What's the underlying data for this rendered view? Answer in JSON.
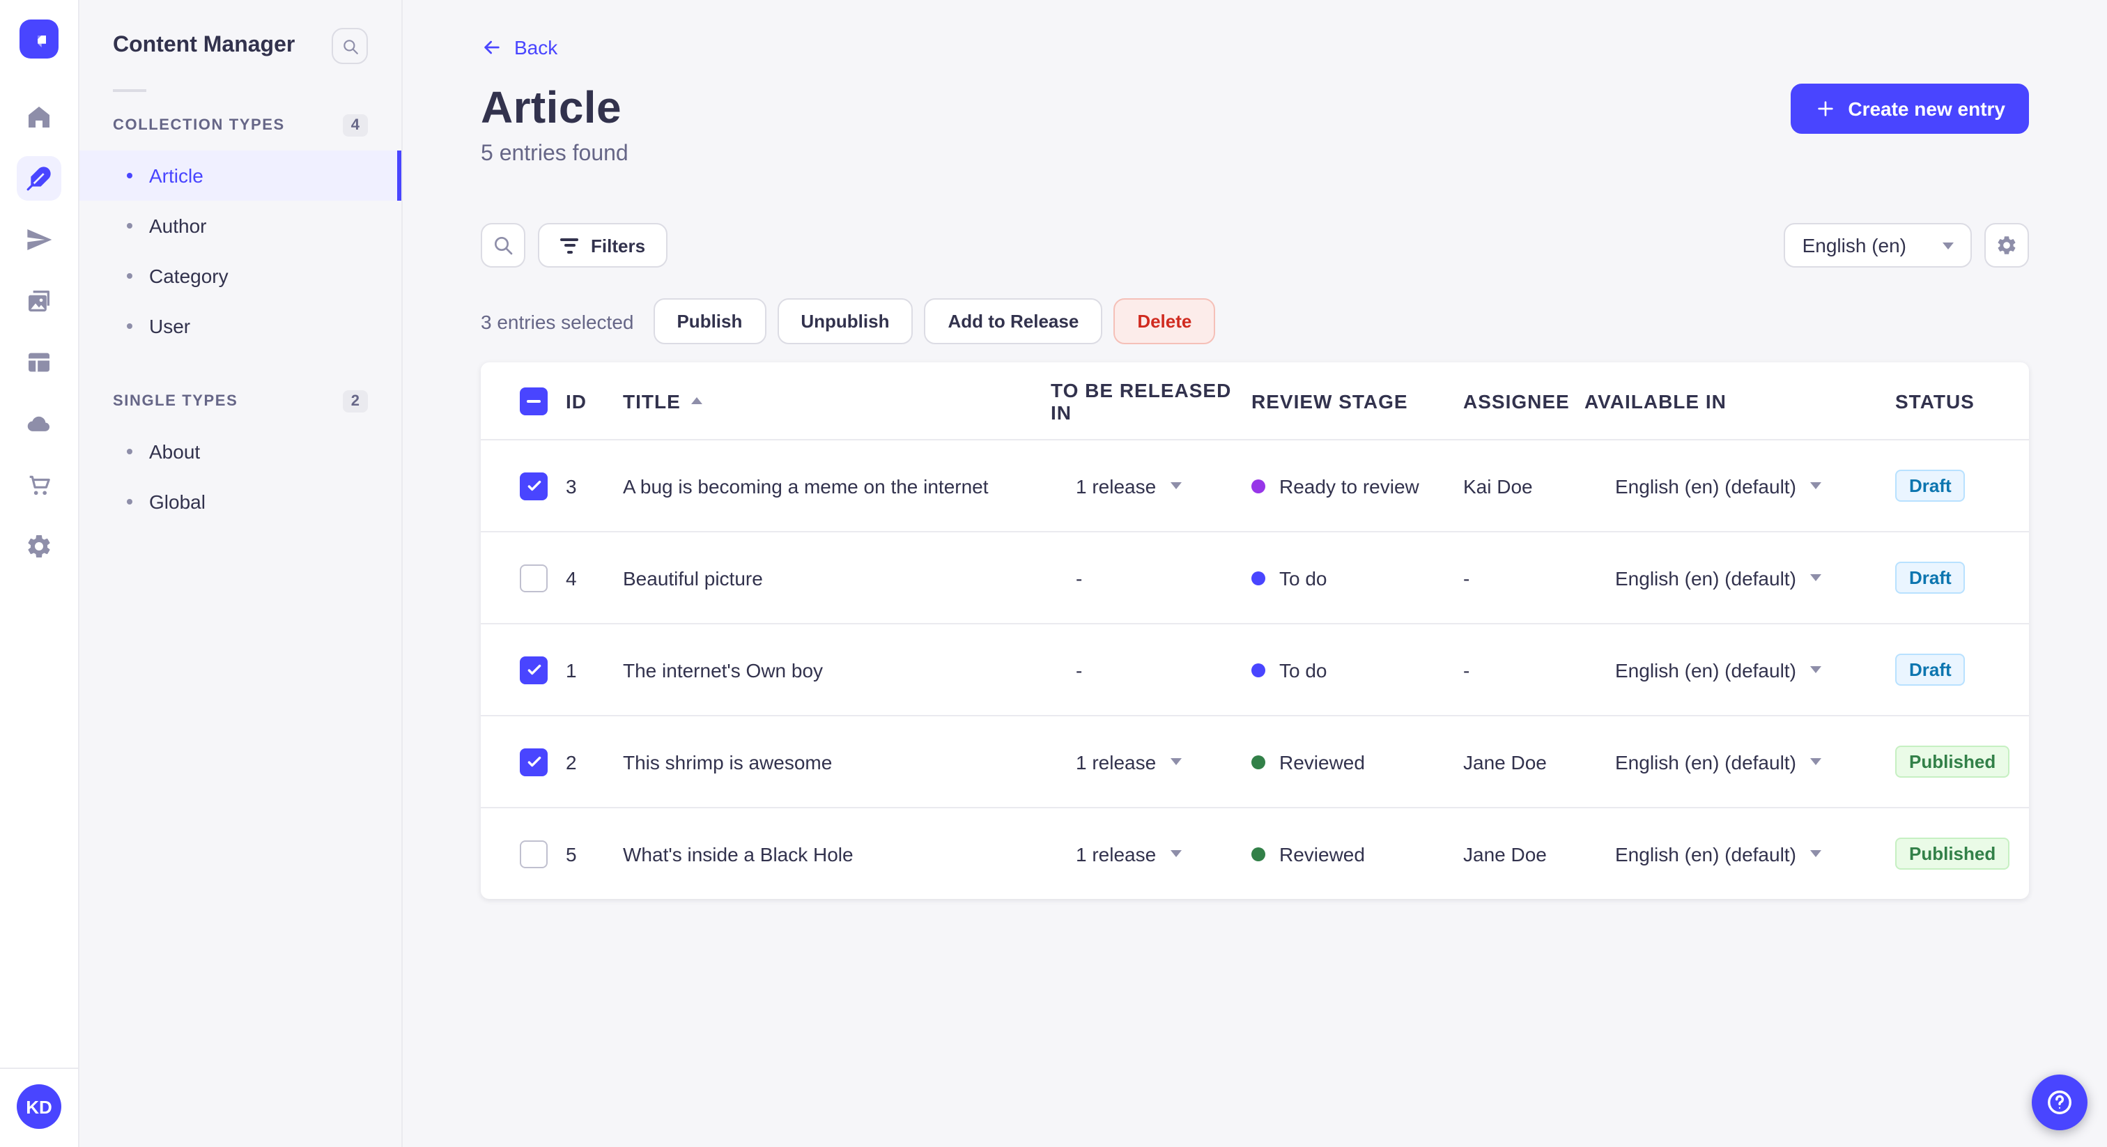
{
  "nav_rail": {
    "logo_icon": "strapi-logo",
    "items": [
      {
        "icon": "home-icon",
        "active": false
      },
      {
        "icon": "content-manager-feather-icon",
        "active": true
      },
      {
        "icon": "releases-paper-plane-icon",
        "active": false
      },
      {
        "icon": "media-library-images-icon",
        "active": false
      },
      {
        "icon": "content-type-builder-layout-icon",
        "active": false
      },
      {
        "icon": "deploy-cloud-icon",
        "active": false
      },
      {
        "icon": "marketplace-cart-icon",
        "active": false
      },
      {
        "icon": "settings-gear-icon",
        "active": false
      }
    ],
    "avatar_initials": "KD"
  },
  "sidebar": {
    "title": "Content Manager",
    "search_icon": "search-icon",
    "sections": [
      {
        "label": "COLLECTION TYPES",
        "count": "4",
        "items": [
          {
            "label": "Article",
            "state": "active"
          },
          {
            "label": "Author",
            "state": ""
          },
          {
            "label": "Category",
            "state": ""
          },
          {
            "label": "User",
            "state": ""
          }
        ]
      },
      {
        "label": "SINGLE TYPES",
        "count": "2",
        "items": [
          {
            "label": "About",
            "state": ""
          },
          {
            "label": "Global",
            "state": ""
          }
        ]
      }
    ]
  },
  "header": {
    "back_label": "Back",
    "title": "Article",
    "subtitle": "5 entries found",
    "create_button_label": "Create new entry"
  },
  "toolbar": {
    "filters_label": "Filters",
    "locale_value": "English (en)"
  },
  "selection": {
    "summary": "3 entries selected",
    "publish_label": "Publish",
    "unpublish_label": "Unpublish",
    "add_to_release_label": "Add to Release",
    "delete_label": "Delete"
  },
  "table": {
    "select_all_state": "indeterminate",
    "sort": {
      "column": "TITLE",
      "direction": "asc"
    },
    "headers": [
      "ID",
      "TITLE",
      "TO BE RELEASED IN",
      "REVIEW STAGE",
      "ASSIGNEE",
      "AVAILABLE IN",
      "STATUS"
    ],
    "rows": [
      {
        "selected": "checked",
        "id": "3",
        "title": "A bug is becoming a meme on the internet",
        "to_be_released_in": "1 release",
        "has_release_menu": true,
        "review_stage": "Ready to review",
        "stage_color": "#9736e8",
        "assignee": "Kai Doe",
        "available_in": "English (en) (default)",
        "status": "Draft",
        "status_variant": "draft"
      },
      {
        "selected": "unchecked",
        "id": "4",
        "title": "Beautiful picture",
        "to_be_released_in": "-",
        "has_release_menu": false,
        "review_stage": "To do",
        "stage_color": "#4945ff",
        "assignee": "-",
        "available_in": "English (en) (default)",
        "status": "Draft",
        "status_variant": "draft"
      },
      {
        "selected": "checked",
        "id": "1",
        "title": "The internet's Own boy",
        "to_be_released_in": "-",
        "has_release_menu": false,
        "review_stage": "To do",
        "stage_color": "#4945ff",
        "assignee": "-",
        "available_in": "English (en) (default)",
        "status": "Draft",
        "status_variant": "draft"
      },
      {
        "selected": "checked",
        "id": "2",
        "title": "This shrimp is awesome",
        "to_be_released_in": "1 release",
        "has_release_menu": true,
        "review_stage": "Reviewed",
        "stage_color": "#328048",
        "assignee": "Jane Doe",
        "available_in": "English (en) (default)",
        "status": "Published",
        "status_variant": "published"
      },
      {
        "selected": "unchecked",
        "id": "5",
        "title": "What's inside a Black Hole",
        "to_be_released_in": "1 release",
        "has_release_menu": true,
        "review_stage": "Reviewed",
        "stage_color": "#328048",
        "assignee": "Jane Doe",
        "available_in": "English (en) (default)",
        "status": "Published",
        "status_variant": "published"
      }
    ]
  },
  "fab": {
    "icon": "help-question-icon"
  },
  "colors": {
    "primary": "#4945ff",
    "primary_light_bg": "#f0f0ff",
    "page_bg": "#f6f6f9",
    "text_dark": "#32324d",
    "text_muted": "#666687",
    "icon_gray": "#8e8ea9",
    "border": "#dcdce4",
    "divider": "#eaeaef",
    "danger_text": "#d02b20",
    "danger_bg": "#fcecea",
    "danger_border": "#f5c0b8",
    "draft_text": "#0c75af",
    "draft_bg": "#eaf5ff",
    "draft_border": "#b8e1ff",
    "published_text": "#328048",
    "published_bg": "#eafbe7",
    "published_border": "#c6f0c2"
  }
}
